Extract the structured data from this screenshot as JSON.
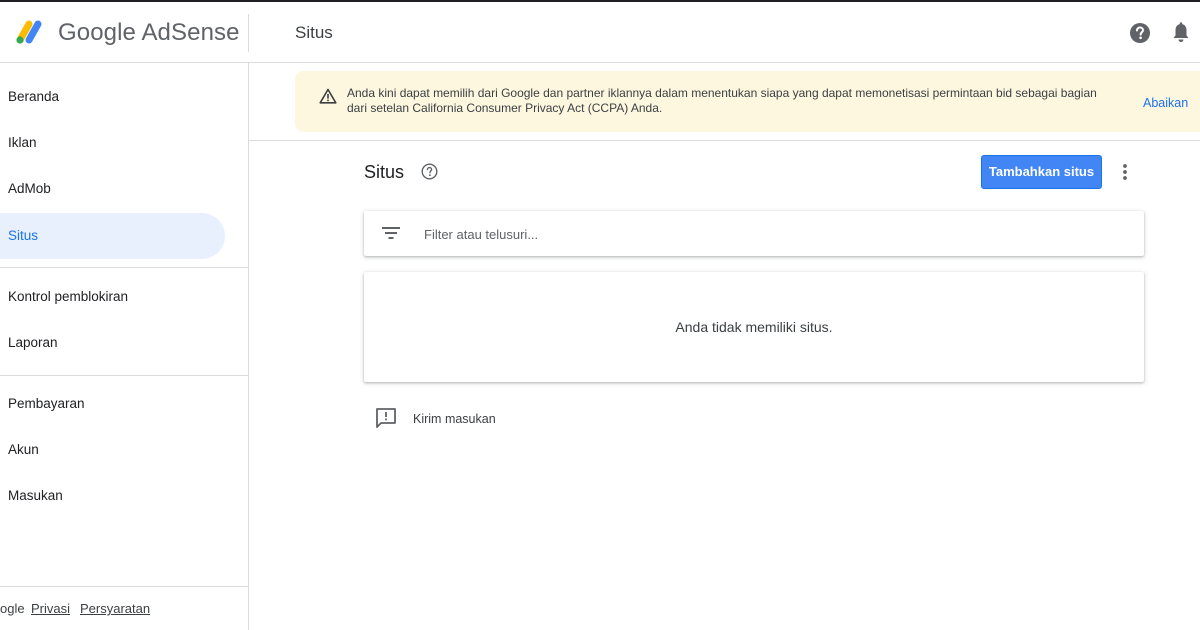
{
  "header": {
    "brand_google": "Google",
    "brand_product": "AdSense",
    "page_heading": "Situs"
  },
  "sidebar": {
    "items": [
      {
        "label": "Beranda",
        "active": false
      },
      {
        "label": "Iklan",
        "active": false
      },
      {
        "label": "AdMob",
        "active": false
      },
      {
        "label": "Situs",
        "active": true
      },
      {
        "label": "Kontrol pemblokiran",
        "active": false
      },
      {
        "label": "Laporan",
        "active": false
      },
      {
        "label": "Pembayaran",
        "active": false
      },
      {
        "label": "Akun",
        "active": false
      },
      {
        "label": "Masukan",
        "active": false
      }
    ],
    "footer": {
      "google": "ogle",
      "privacy": "Privasi",
      "terms": "Persyaratan"
    }
  },
  "banner": {
    "text": "Anda kini dapat memilih dari Google dan partner iklannya dalam menentukan siapa yang dapat memonetisasi permintaan bid sebagai bagian dari setelan California Consumer Privacy Act (CCPA) Anda.",
    "dismiss_label": "Abaikan",
    "icon": "warning-icon"
  },
  "main": {
    "title": "Situs",
    "add_button_label": "Tambahkan situs",
    "filter_placeholder": "Filter atau telusuri...",
    "empty_message": "Anda tidak memiliki situs.",
    "feedback_label": "Kirim masukan"
  },
  "colors": {
    "accent": "#1a73e8",
    "button": "#4285f4",
    "active_nav_bg": "#e8f0fe",
    "banner_bg": "#fef7e0",
    "logo_yellow": "#fbbc04",
    "logo_blue": "#4285f4",
    "logo_green": "#34a853"
  }
}
